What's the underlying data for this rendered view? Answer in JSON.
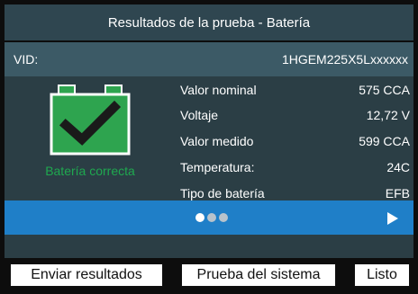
{
  "header": {
    "title": "Resultados de la prueba - Batería"
  },
  "vid": {
    "label": "VID:",
    "value": "1HGEM225X5Lxxxxxx"
  },
  "battery": {
    "status": "Batería correcta",
    "status_color": "#1fa84f",
    "icon": "battery-check-icon"
  },
  "results": [
    {
      "label": "Valor nominal",
      "value": "575 CCA"
    },
    {
      "label": "Voltaje",
      "value": "12,72 V"
    },
    {
      "label": "Valor medido",
      "value": "599 CCA"
    },
    {
      "label": "Temperatura:",
      "value": "24C"
    },
    {
      "label": "Tipo de batería",
      "value": "EFB"
    }
  ],
  "pager": {
    "pages": 3,
    "current": 1,
    "accent": "#1f7fc8",
    "next_icon": "play-arrow-icon"
  },
  "buttons": {
    "send": "Enviar resultados",
    "system_test": "Prueba del sistema",
    "done": "Listo"
  }
}
